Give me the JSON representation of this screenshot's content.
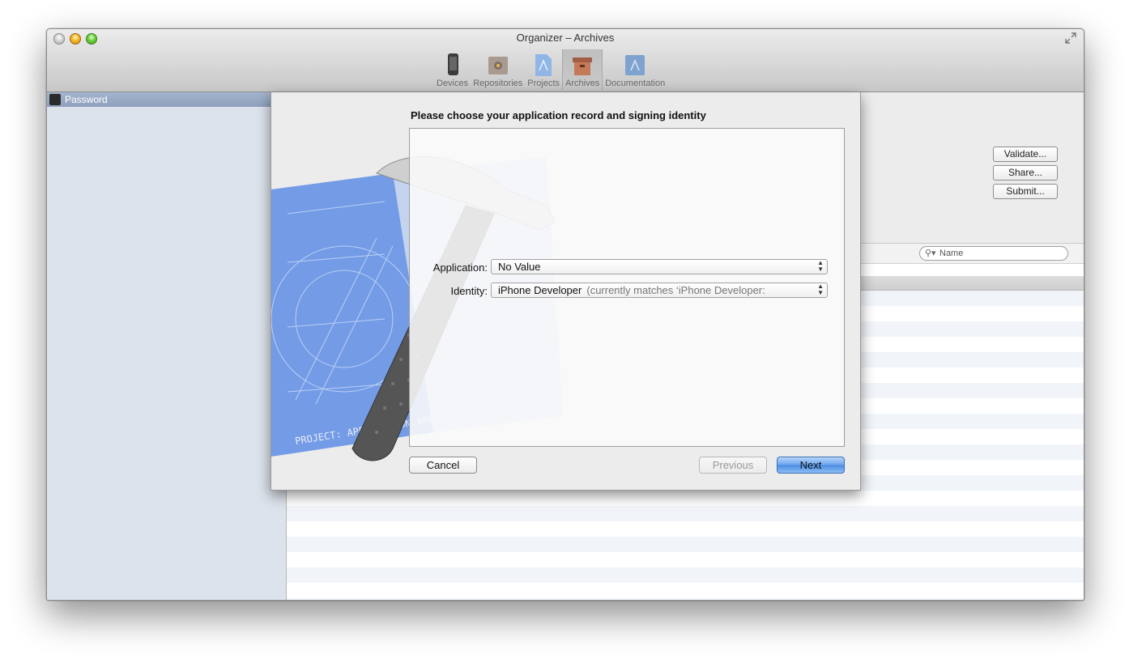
{
  "window": {
    "title": "Organizer – Archives"
  },
  "toolbar": {
    "items": [
      {
        "label": "Devices",
        "icon": "device-icon"
      },
      {
        "label": "Repositories",
        "icon": "repositories-icon"
      },
      {
        "label": "Projects",
        "icon": "projects-icon"
      },
      {
        "label": "Archives",
        "icon": "archives-icon",
        "active": true
      },
      {
        "label": "Documentation",
        "icon": "documentation-icon"
      }
    ]
  },
  "sidebar": {
    "items": [
      {
        "label": "Password",
        "selected": true
      }
    ]
  },
  "detail": {
    "buttons": {
      "validate": "Validate...",
      "share": "Share...",
      "submit": "Submit..."
    },
    "search": {
      "placeholder": "Name"
    }
  },
  "sheet": {
    "heading": "Please choose your application record and signing identity",
    "application": {
      "label": "Application:",
      "value": "No Value"
    },
    "identity": {
      "label": "Identity:",
      "value": "iPhone Developer",
      "hint": "(currently matches ‘iPhone Developer:"
    },
    "buttons": {
      "cancel": "Cancel",
      "previous": "Previous",
      "next": "Next"
    }
  },
  "colors": {
    "accent": "#5a97e6",
    "sidebar_selection": "#98aac5",
    "stripe": "#f1f5fa"
  }
}
